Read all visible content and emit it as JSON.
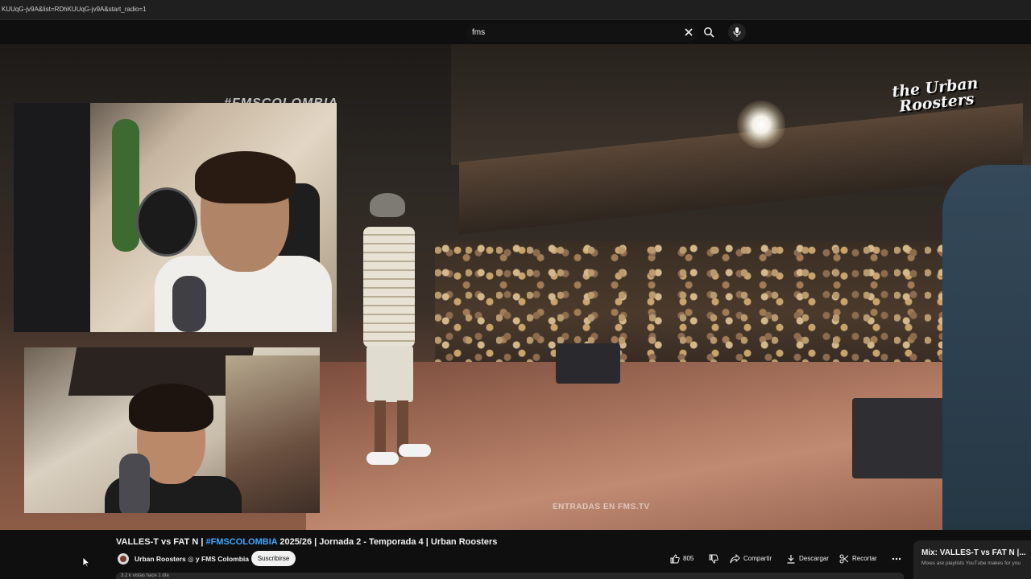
{
  "browser": {
    "url_fragment": "KUUqG-jv9A&list=RDhKUUqG-jv9A&start_radio=1"
  },
  "header": {
    "search_query": "fms"
  },
  "video": {
    "overlay_banner": "#FMSCOLOMBIA",
    "watermark_line1": "the Urban",
    "watermark_line2": "Roosters",
    "footer_text": "ENTRADAS EN FMS.TV"
  },
  "video_info": {
    "title_prefix": "VALLES-T vs FAT N | ",
    "title_hashtag": "#FMSCOLOMBIA",
    "title_suffix": " 2025/26 | Jornada 2 - Temporada 4 | Urban Roosters",
    "channel": "Urban Roosters ◎ y FMS Colombia",
    "subscribe_label": "Suscribirse",
    "like_count": "805",
    "share_label": "Compartir",
    "download_label": "Descargar",
    "clip_label": "Recortar",
    "description_hint": "3.2 k vistas hace 1 día"
  },
  "playlist": {
    "title": "Mix: VALLES-T vs FAT N |...",
    "subtitle": "Mixes are playlists YouTube makes for you"
  },
  "icons": [
    "clear-icon",
    "search-icon",
    "mic-icon",
    "thumbs-up-icon",
    "thumbs-down-icon",
    "share-icon",
    "download-icon",
    "scissors-icon",
    "more-icon",
    "cursor-icon"
  ]
}
